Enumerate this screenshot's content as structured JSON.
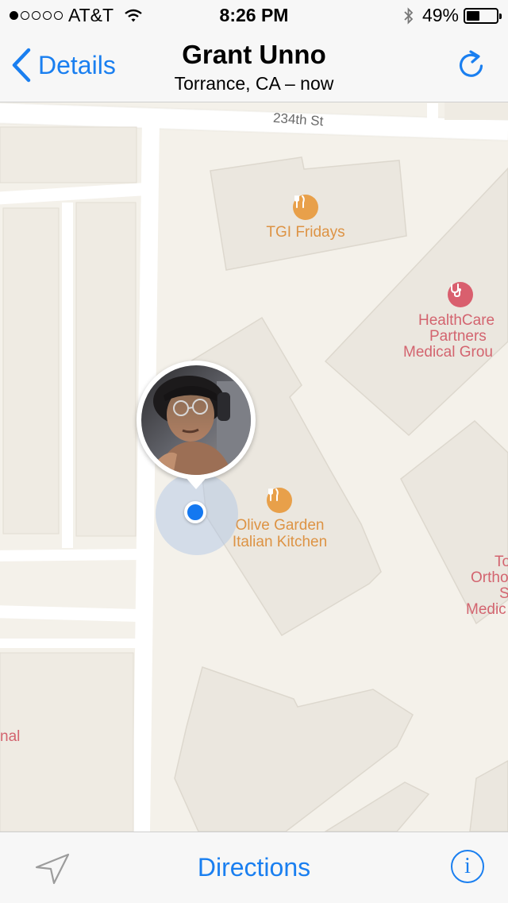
{
  "status_bar": {
    "carrier": "AT&T",
    "signal_dots_filled": 1,
    "signal_dots_total": 5,
    "time": "8:26 PM",
    "battery_percent": "49%",
    "battery_level": 0.49,
    "icons": [
      "wifi-icon",
      "bluetooth-icon",
      "battery-icon"
    ]
  },
  "nav": {
    "back_label": "Details",
    "title": "Grant Unno",
    "subtitle": "Torrance, CA – now",
    "refresh_icon": "refresh-icon"
  },
  "map": {
    "street": "234th St",
    "pois": [
      {
        "name": "TGI Fridays",
        "icon": "restaurant-icon",
        "color": "#e8a04a"
      },
      {
        "name": "HealthCare Partners Medical Grou",
        "lines": [
          "HealthCare",
          "Partners",
          "Medical Grou"
        ],
        "icon": "medical-icon",
        "color": "#d95f6e"
      },
      {
        "name": "Olive Garden Italian Kitchen",
        "lines": [
          "Olive Garden",
          "Italian Kitchen"
        ],
        "icon": "restaurant-icon",
        "color": "#e8a04a"
      }
    ],
    "clipped_labels": {
      "right": [
        "To",
        "Ortho",
        "S",
        "Medic"
      ],
      "left": "nal"
    },
    "user_marker": {
      "photo": "user-avatar",
      "location_dot_color": "#1478f0"
    }
  },
  "toolbar": {
    "locate_icon": "location-arrow-icon",
    "directions_label": "Directions",
    "info_icon": "info-icon",
    "info_glyph": "i"
  },
  "colors": {
    "accent": "#1a7ff0",
    "map_background": "#f4f1ea",
    "building": "#ece8df",
    "road": "#ffffff",
    "restaurant": "#e8a04a",
    "medical": "#d95f6e"
  }
}
